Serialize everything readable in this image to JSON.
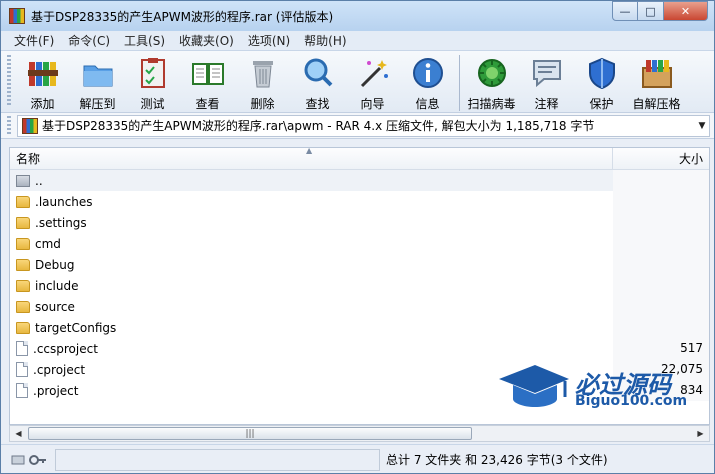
{
  "window": {
    "title": "基于DSP28335的产生APWM波形的程序.rar (评估版本)",
    "controls": {
      "minimize": "—",
      "maximize": "□",
      "close": "✕"
    }
  },
  "menu": [
    "文件(F)",
    "命令(C)",
    "工具(S)",
    "收藏夹(O)",
    "选项(N)",
    "帮助(H)"
  ],
  "toolbar": [
    {
      "label": "添加",
      "icon": "add-books-icon"
    },
    {
      "label": "解压到",
      "icon": "extract-folder-icon"
    },
    {
      "label": "测试",
      "icon": "test-clipboard-icon"
    },
    {
      "label": "查看",
      "icon": "view-book-icon"
    },
    {
      "label": "删除",
      "icon": "trash-icon"
    },
    {
      "label": "查找",
      "icon": "find-magnifier-icon"
    },
    {
      "label": "向导",
      "icon": "wizard-wand-icon"
    },
    {
      "label": "信息",
      "icon": "info-icon"
    },
    {
      "label": "扫描病毒",
      "icon": "virus-scan-icon"
    },
    {
      "label": "注释",
      "icon": "comment-icon"
    },
    {
      "label": "保护",
      "icon": "shield-icon"
    },
    {
      "label": "自解压格",
      "icon": "sfx-box-icon"
    }
  ],
  "address": {
    "path": "基于DSP28335的产生APWM波形的程序.rar\\apwm - RAR 4.x 压缩文件, 解包大小为 1,185,718 字节"
  },
  "list": {
    "columns": {
      "name": "名称",
      "size": "大小"
    },
    "rows": [
      {
        "name": "..",
        "type": "up",
        "size": ""
      },
      {
        "name": ".launches",
        "type": "folder",
        "size": ""
      },
      {
        "name": ".settings",
        "type": "folder",
        "size": ""
      },
      {
        "name": "cmd",
        "type": "folder",
        "size": ""
      },
      {
        "name": "Debug",
        "type": "folder",
        "size": ""
      },
      {
        "name": "include",
        "type": "folder",
        "size": ""
      },
      {
        "name": "source",
        "type": "folder",
        "size": ""
      },
      {
        "name": "targetConfigs",
        "type": "folder",
        "size": ""
      },
      {
        "name": ".ccsproject",
        "type": "file",
        "size": "517"
      },
      {
        "name": ".cproject",
        "type": "file",
        "size": "22,075"
      },
      {
        "name": ".project",
        "type": "file",
        "size": "834"
      }
    ]
  },
  "status": {
    "text": "总计 7 文件夹 和 23,426 字节(3 个文件)"
  },
  "watermark": {
    "title": "必过源码",
    "url": "Biguo100.com"
  },
  "colors": {
    "accent": "#1d5aa8",
    "folder": "#e7b740"
  }
}
